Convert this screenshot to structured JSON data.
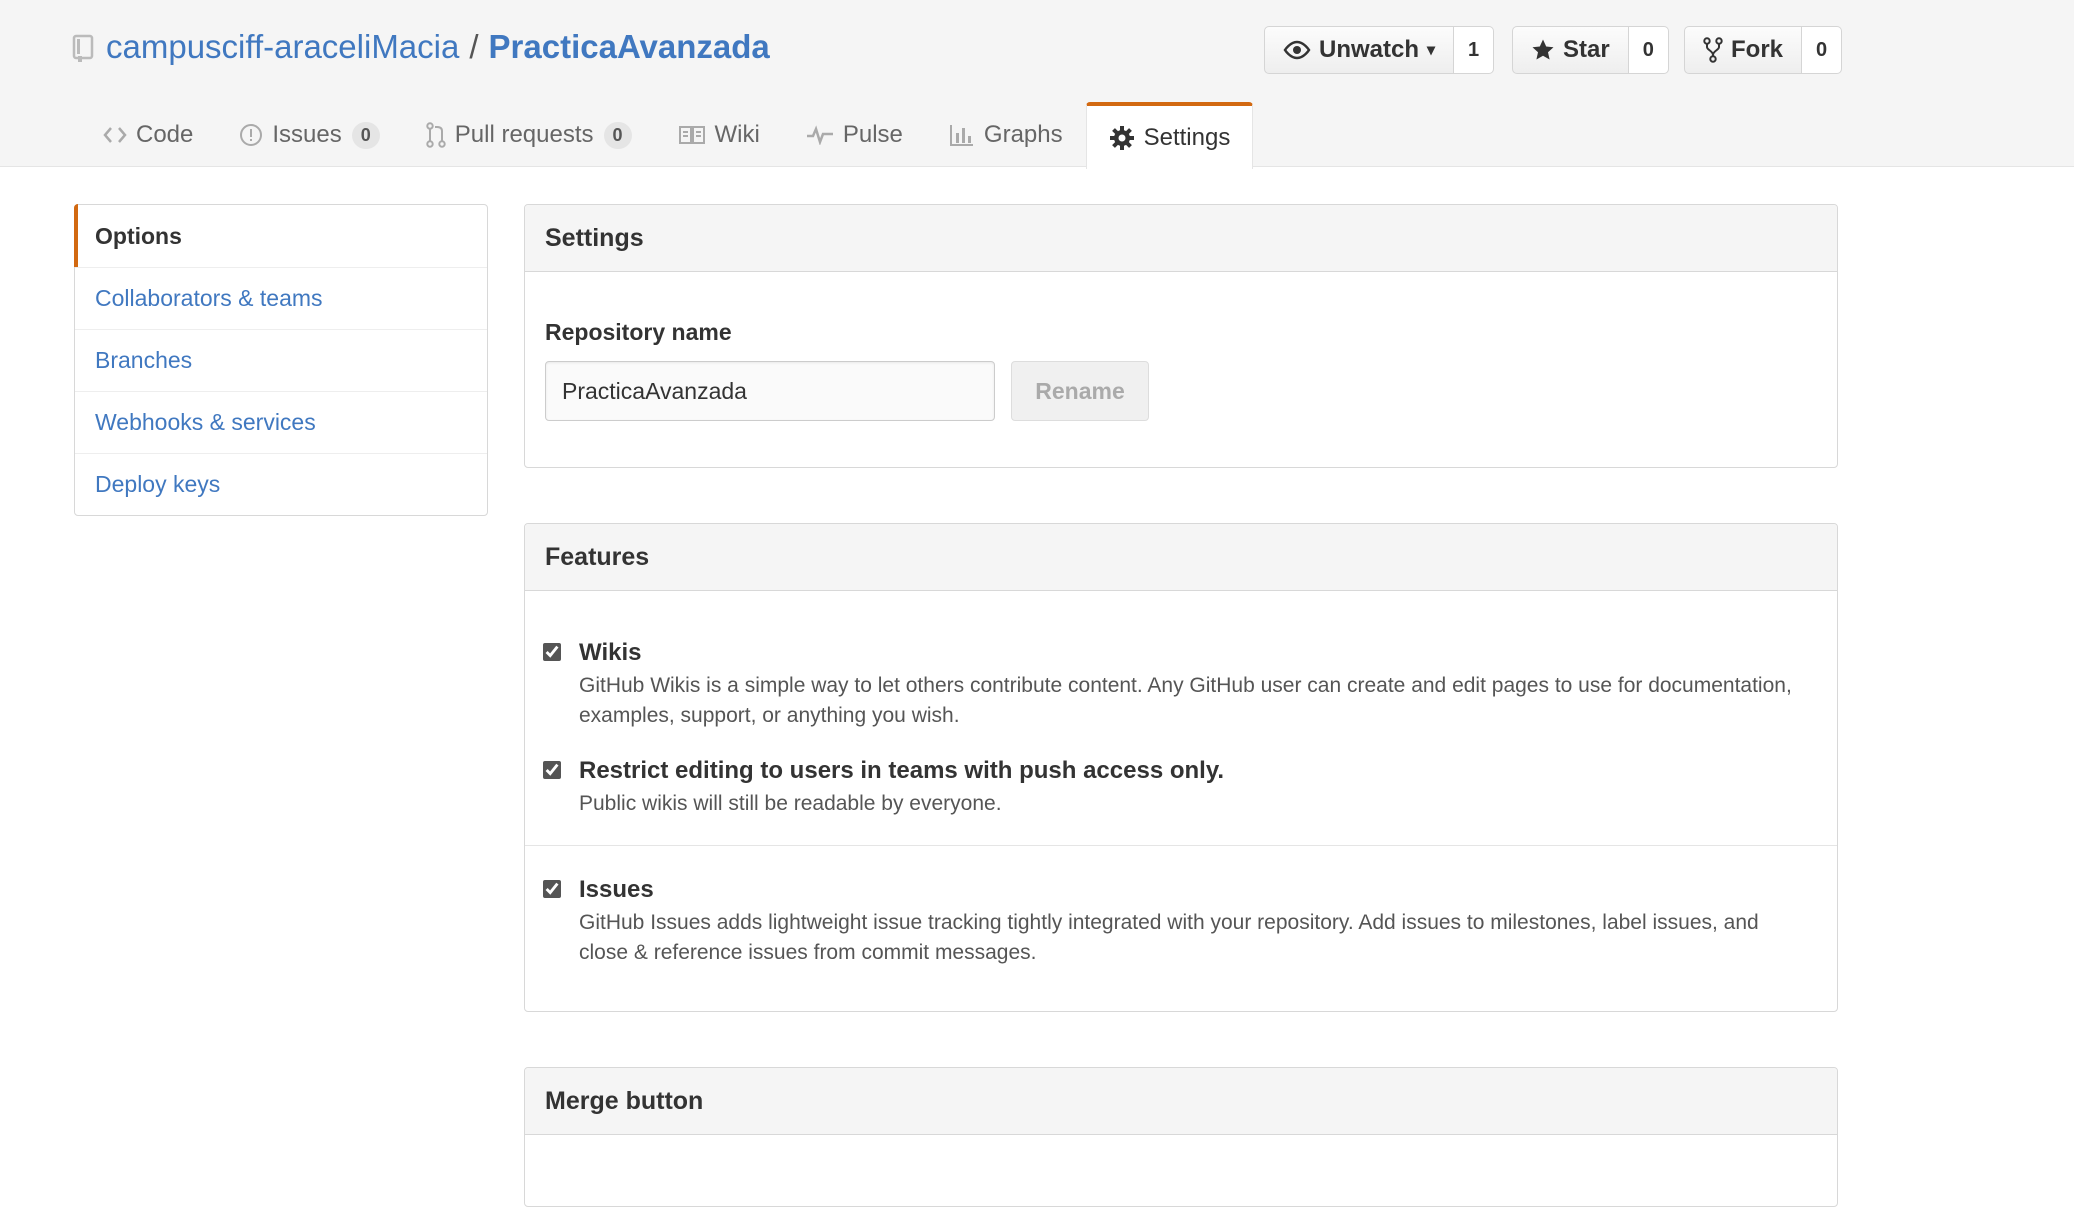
{
  "header": {
    "owner": "campusciff-araceliMacia",
    "separator": "/",
    "repo": "PracticaAvanzada",
    "repo_icon": "repo-icon"
  },
  "actions": {
    "watch": {
      "label": "Unwatch",
      "count": "1",
      "icon": "eye-icon"
    },
    "star": {
      "label": "Star",
      "count": "0",
      "icon": "star-icon"
    },
    "fork": {
      "label": "Fork",
      "count": "0",
      "icon": "fork-icon"
    }
  },
  "nav": {
    "code": {
      "label": "Code",
      "icon": "code-icon"
    },
    "issues": {
      "label": "Issues",
      "count": "0",
      "icon": "issue-icon"
    },
    "pulls": {
      "label": "Pull requests",
      "count": "0",
      "icon": "pull-request-icon"
    },
    "wiki": {
      "label": "Wiki",
      "icon": "book-icon"
    },
    "pulse": {
      "label": "Pulse",
      "icon": "pulse-icon"
    },
    "graphs": {
      "label": "Graphs",
      "icon": "graph-icon"
    },
    "settings": {
      "label": "Settings",
      "icon": "gear-icon"
    }
  },
  "sidebar": {
    "items": [
      {
        "label": "Options",
        "selected": true
      },
      {
        "label": "Collaborators & teams"
      },
      {
        "label": "Branches"
      },
      {
        "label": "Webhooks & services"
      },
      {
        "label": "Deploy keys"
      }
    ]
  },
  "settings_box": {
    "title": "Settings",
    "repo_name_label": "Repository name",
    "repo_name_value": "PracticaAvanzada",
    "rename_label": "Rename"
  },
  "features_box": {
    "title": "Features",
    "wikis": {
      "checked": true,
      "title": "Wikis",
      "desc": "GitHub Wikis is a simple way to let others contribute content. Any GitHub user can create and edit pages to use for documentation, examples, support, or anything you wish."
    },
    "restrict": {
      "checked": true,
      "title": "Restrict editing to users in teams with push access only.",
      "desc": "Public wikis will still be readable by everyone."
    },
    "issues": {
      "checked": true,
      "title": "Issues",
      "desc": "GitHub Issues adds lightweight issue tracking tightly integrated with your repository. Add issues to milestones, label issues, and close & reference issues from commit messages."
    }
  },
  "merge_box": {
    "title": "Merge button"
  },
  "colors": {
    "link": "#4078c0",
    "accent": "#d26911",
    "header_bg": "#f5f5f5"
  }
}
